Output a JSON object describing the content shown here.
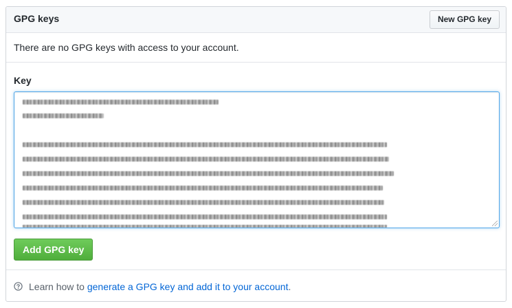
{
  "header": {
    "title": "GPG keys",
    "new_key_button": "New GPG key"
  },
  "empty_state": {
    "message": "There are no GPG keys with access to your account."
  },
  "form": {
    "key_label": "Key",
    "submit_button": "Add GPG key"
  },
  "footer": {
    "prefix": "Learn how to ",
    "link_text": "generate a GPG key and add it to your account",
    "suffix": ".",
    "icon": "question-circle-icon"
  },
  "colors": {
    "accent_link": "#0366d6",
    "submit_green": "#4fae3b",
    "focus_border": "#51a7e8"
  }
}
